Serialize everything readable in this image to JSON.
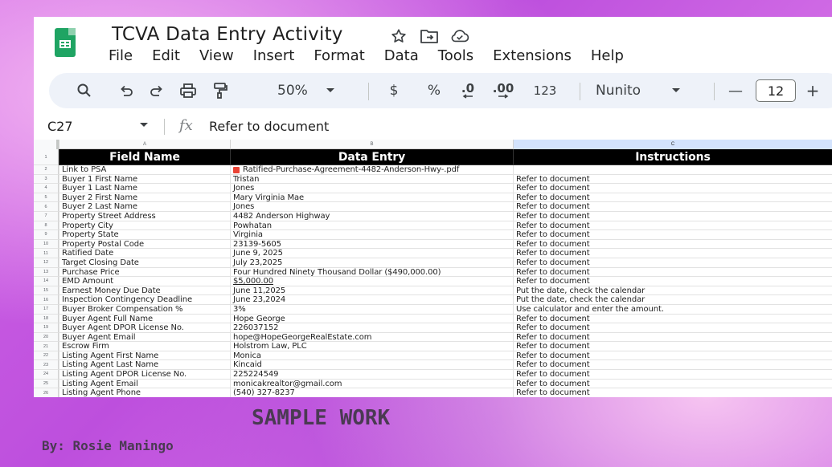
{
  "window": {
    "title": "TCVA Data Entry Activity",
    "title_icons": [
      "star-icon",
      "move-to-folder-icon",
      "cloud-saved-icon"
    ]
  },
  "menu": [
    "File",
    "Edit",
    "View",
    "Insert",
    "Format",
    "Data",
    "Tools",
    "Extensions",
    "Help"
  ],
  "toolbar": {
    "zoom": "50%",
    "currency": "$",
    "percent": "%",
    "decrease_decimal": ".0",
    "increase_decimal": ".00",
    "number_format": "123",
    "font": "Nunito",
    "font_size": "12",
    "minus": "—",
    "plus": "+"
  },
  "formula_bar": {
    "cell_ref": "C27",
    "fx": "fx",
    "content": "Refer to document"
  },
  "columns": [
    "A",
    "B",
    "C"
  ],
  "headers": {
    "a": "Field Name",
    "b": "Data Entry",
    "c": "Instructions"
  },
  "rows": [
    {
      "num": "2",
      "a": "Link to PSA",
      "b": "Ratified-Purchase-Agreement-4482-Anderson-Hwy-.pdf",
      "c": ""
    },
    {
      "num": "3",
      "a": "Buyer 1 First Name",
      "b": "Tristan",
      "c": "Refer to document"
    },
    {
      "num": "4",
      "a": "Buyer 1 Last Name",
      "b": "Jones",
      "c": "Refer to document"
    },
    {
      "num": "5",
      "a": "Buyer 2 First Name",
      "b": "Mary Virginia Mae",
      "c": "Refer to document"
    },
    {
      "num": "6",
      "a": "Buyer 2 Last Name",
      "b": "Jones",
      "c": "Refer to document"
    },
    {
      "num": "7",
      "a": "Property Street Address",
      "b": "4482 Anderson Highway",
      "c": "Refer to document"
    },
    {
      "num": "8",
      "a": "Property City",
      "b": "Powhatan",
      "c": "Refer to document"
    },
    {
      "num": "9",
      "a": "Property State",
      "b": "Virginia",
      "c": "Refer to document"
    },
    {
      "num": "10",
      "a": "Property Postal Code",
      "b": "23139-5605",
      "c": "Refer to document"
    },
    {
      "num": "11",
      "a": "Ratified Date",
      "b": "June 9, 2025",
      "c": "Refer to document"
    },
    {
      "num": "12",
      "a": "Target Closing Date",
      "b": "July 23,2025",
      "c": "Refer to document"
    },
    {
      "num": "13",
      "a": "Purchase Price",
      "b": "Four Hundred Ninety Thousand Dollar  ($490,000.00)",
      "c": "Refer to document"
    },
    {
      "num": "14",
      "a": "EMD Amount",
      "b": "$5,000.00",
      "c": "Refer to document"
    },
    {
      "num": "15",
      "a": "Earnest Money Due Date",
      "b": "June 11,2025",
      "c": "Put the date, check the calendar"
    },
    {
      "num": "16",
      "a": "Inspection Contingency Deadline",
      "b": "June 23,2024",
      "c": "Put the date, check the calendar"
    },
    {
      "num": "17",
      "a": "Buyer Broker Compensation %",
      "b": "3%",
      "c": "Use calculator and enter the amount."
    },
    {
      "num": "18",
      "a": "Buyer Agent Full Name",
      "b": "Hope George",
      "c": "Refer to document"
    },
    {
      "num": "19",
      "a": "Buyer Agent DPOR License No.",
      "b": "226037152",
      "c": "Refer to document"
    },
    {
      "num": "20",
      "a": "Buyer Agent Email",
      "b": "hope@HopeGeorgeRealEstate.com",
      "c": "Refer to document"
    },
    {
      "num": "21",
      "a": "Escrow Firm",
      "b": "Holstrom Law, PLC",
      "c": "Refer to document"
    },
    {
      "num": "22",
      "a": "Listing Agent First Name",
      "b": "Monica",
      "c": "Refer to document"
    },
    {
      "num": "23",
      "a": "Listing Agent Last Name",
      "b": "Kincaid",
      "c": "Refer to document"
    },
    {
      "num": "24",
      "a": "Listing Agent DPOR License No.",
      "b": "225224549",
      "c": "Refer to document"
    },
    {
      "num": "25",
      "a": "Listing Agent Email",
      "b": "monicakrealtor@gmail.com",
      "c": "Refer to document"
    },
    {
      "num": "26",
      "a": "Listing Agent Phone",
      "b": "(540) 327-8237",
      "c": "Refer to document"
    }
  ],
  "overlay": {
    "sample": "SAMPLE WORK",
    "byline": "By: Rosie Maningo"
  },
  "colors": {
    "sheets_green": "#1fa463",
    "toolbar_bg": "#eef2f9",
    "header_row_bg": "#000000",
    "background_purple": "#c457e1"
  }
}
